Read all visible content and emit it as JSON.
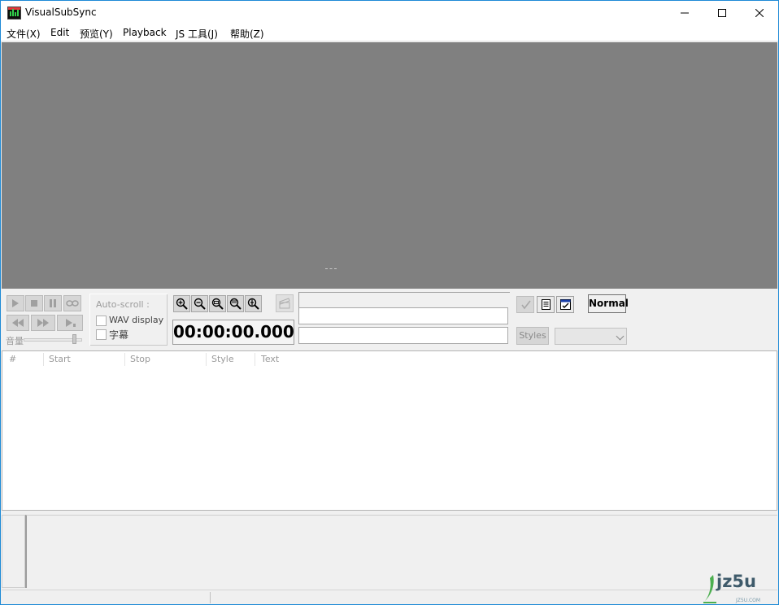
{
  "window": {
    "title": "VisualSubSync",
    "controls": {
      "minimize": "minimize",
      "maximize": "maximize",
      "close": "close"
    }
  },
  "menu": [
    {
      "label": "文件(X)"
    },
    {
      "label": "Edit"
    },
    {
      "label": "预览(Y)"
    },
    {
      "label": "Playback"
    },
    {
      "label": "JS 工具(J)"
    },
    {
      "label": "帮助(Z)"
    }
  ],
  "playback": {
    "buttons": [
      "play-icon",
      "stop-icon",
      "pause-icon",
      "loop-icon",
      "rewind-icon",
      "fast-forward-icon",
      "play-to-end-icon"
    ],
    "volume_label": "音量",
    "volume_level": 0.87
  },
  "autoscroll": {
    "label": "Auto-scroll :",
    "wav_display": {
      "label": "WAV display",
      "checked": false
    },
    "subtitles": {
      "label": "字幕",
      "checked": false
    }
  },
  "zoom": {
    "buttons": [
      "zoom-in-icon",
      "zoom-out-icon",
      "zoom-selection-icon",
      "zoom-all-icon",
      "zoom-vertical-icon"
    ]
  },
  "timecode": "00:00:00.000",
  "right_tools": {
    "mode_label": "Normal",
    "styles_label": "Styles",
    "style_selected": ""
  },
  "list": {
    "columns": [
      "#",
      "Start",
      "Stop",
      "Style",
      "Text"
    ],
    "rows": []
  },
  "watermark": {
    "text": "jz5u",
    "sub": "JZ5U.COM"
  },
  "colors": {
    "video_bg": "#808080",
    "window_border": "#1e8ad6",
    "panel_bg": "#f0f0f0"
  }
}
